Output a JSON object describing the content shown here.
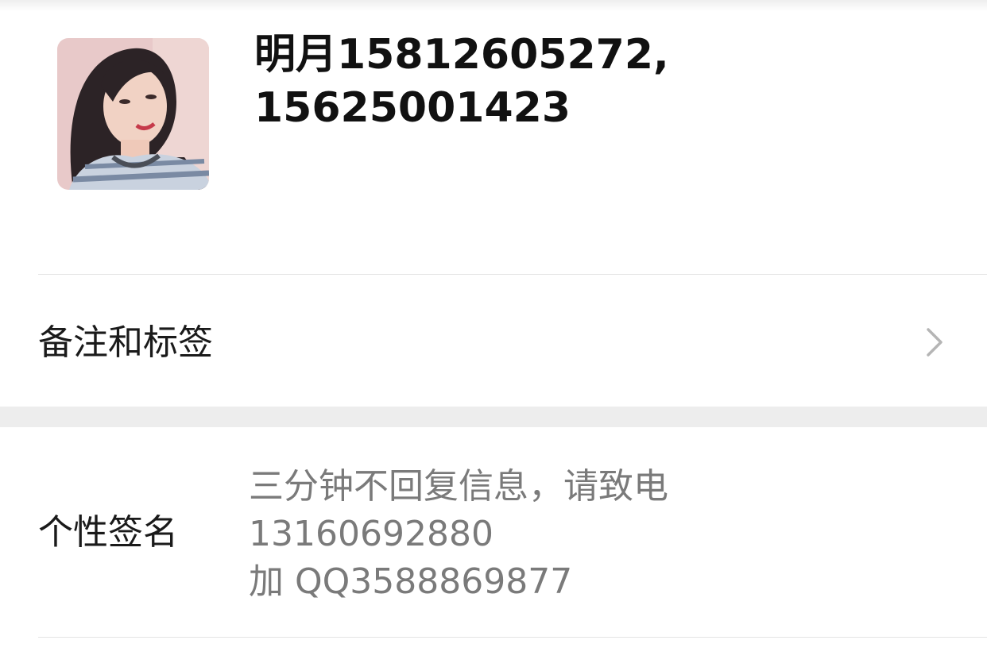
{
  "profile": {
    "name_line1": "明月15812605272,",
    "name_line2": "15625001423",
    "avatar_icon": "profile-photo"
  },
  "rows": {
    "remarks": {
      "label": "备注和标签",
      "icon": "chevron-right-icon"
    },
    "signature": {
      "label": "个性签名",
      "lines": [
        "三分钟不回复信息，请致电",
        "13160692880",
        "加 QQ3588869877"
      ]
    }
  },
  "colors": {
    "background": "#ffffff",
    "section_gap": "#ededed",
    "divider": "#e3e3e3",
    "primary_text": "#111111",
    "secondary_text": "#7a7a7a",
    "chevron": "#b5b5b5"
  }
}
